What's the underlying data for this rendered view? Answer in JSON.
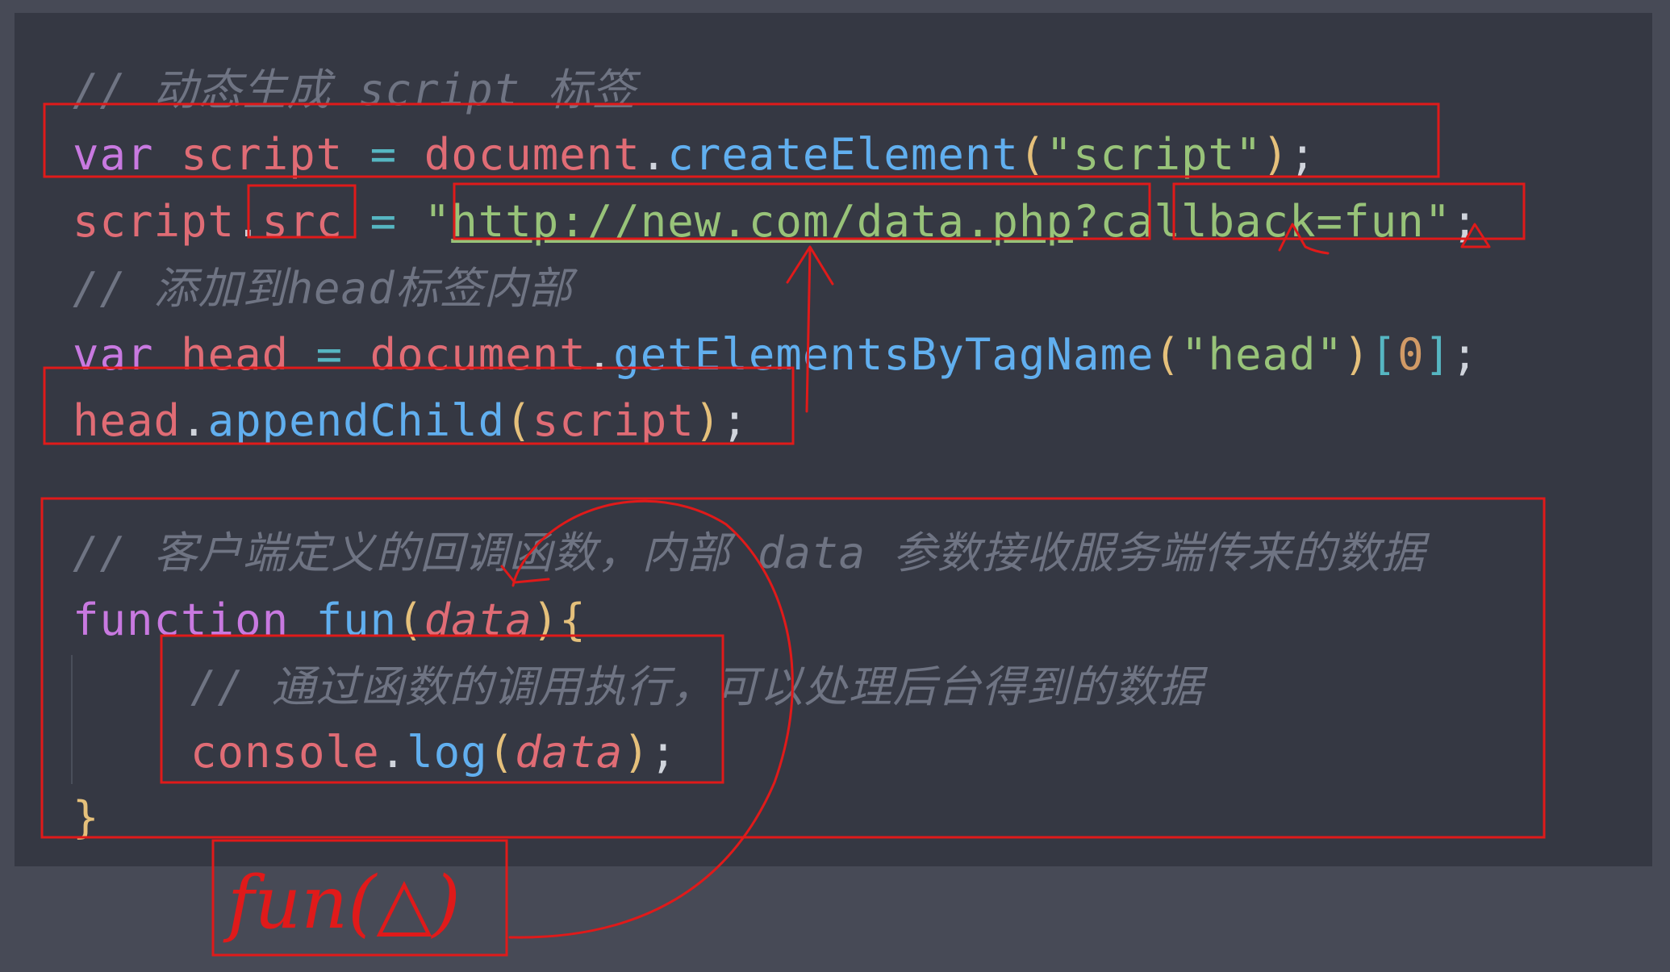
{
  "code": {
    "comment_1": "// 动态生成 script 标签",
    "line_2": {
      "kw": "var",
      "name": "script",
      "eq": "=",
      "obj": "document",
      "dot": ".",
      "method": "createElement",
      "open": "(",
      "arg": "\"script\"",
      "close": ")",
      "semi": ";"
    },
    "line_3": {
      "obj": "script",
      "dot": ".",
      "prop": "src",
      "eq": "=",
      "quote_open": "\"",
      "url": "http://new.com/data.php",
      "qmark": "?",
      "query": "callback=fun",
      "quote_close": "\"",
      "semi": ";"
    },
    "comment_4": "// 添加到head标签内部",
    "line_5": {
      "kw": "var",
      "name": "head",
      "eq": "=",
      "obj": "document",
      "dot": ".",
      "method": "getElementsByTagName",
      "open": "(",
      "arg": "\"head\"",
      "close": ")",
      "idx_open": "[",
      "idx": "0",
      "idx_close": "]",
      "semi": ";"
    },
    "line_6": {
      "obj": "head",
      "dot": ".",
      "method": "appendChild",
      "open": "(",
      "arg": "script",
      "close": ")",
      "semi": ";"
    },
    "comment_8": "// 客户端定义的回调函数，内部 data 参数接收服务端传来的数据",
    "line_9": {
      "kw": "function",
      "name": "fun",
      "open": "(",
      "param": "data",
      "close": ")",
      "brace": "{"
    },
    "comment_10": "// 通过函数的调用执行，可以处理后台得到的数据",
    "line_11": {
      "obj": "console",
      "dot": ".",
      "method": "log",
      "open": "(",
      "param": "data",
      "close": ")",
      "semi": ";"
    },
    "line_12": {
      "brace": "}"
    }
  },
  "annotations": {
    "handwritten_call": "fun(△)",
    "stroke_color": "#e01a1a"
  }
}
